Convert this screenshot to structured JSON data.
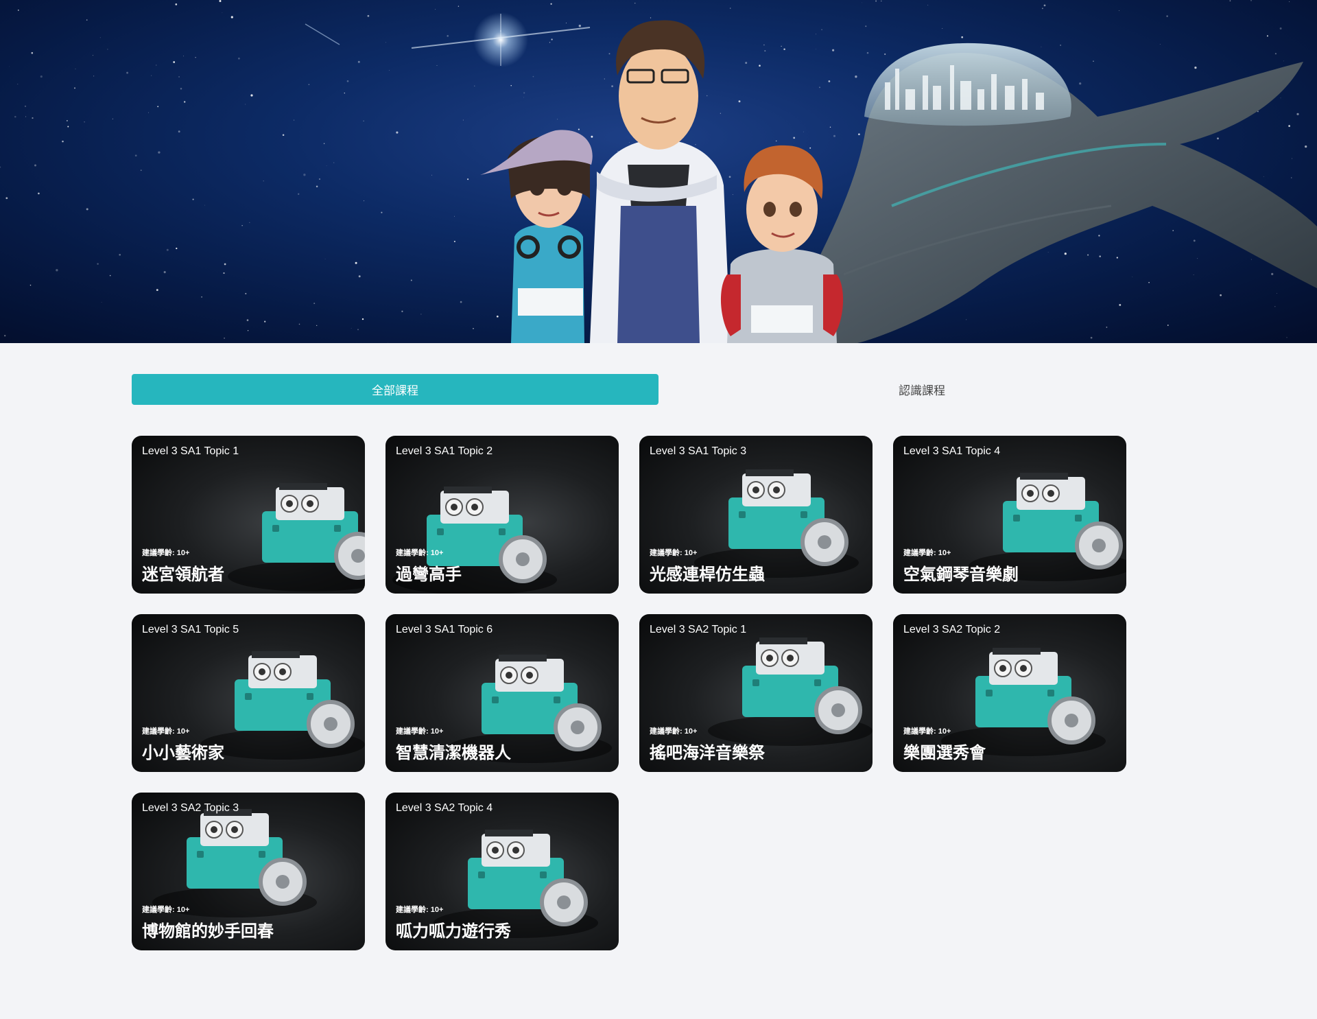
{
  "tabs": [
    {
      "label": "全部課程",
      "active": true
    },
    {
      "label": "認識課程",
      "active": false
    }
  ],
  "colors": {
    "accent": "#26b6be",
    "robot": "#2fb7ad"
  },
  "courses": [
    {
      "topic": "Level 3 SA1 Topic 1",
      "age": "建議學齡: 10+",
      "title": "迷宮領航者"
    },
    {
      "topic": "Level 3 SA1 Topic 2",
      "age": "建議學齡: 10+",
      "title": "過彎高手"
    },
    {
      "topic": "Level 3 SA1 Topic 3",
      "age": "建議學齡: 10+",
      "title": "光感連桿仿生蟲"
    },
    {
      "topic": "Level 3 SA1 Topic 4",
      "age": "建議學齡: 10+",
      "title": "空氣鋼琴音樂劇"
    },
    {
      "topic": "Level 3 SA1 Topic 5",
      "age": "建議學齡: 10+",
      "title": "小小藝術家"
    },
    {
      "topic": "Level 3 SA1 Topic 6",
      "age": "建議學齡: 10+",
      "title": "智慧清潔機器人"
    },
    {
      "topic": "Level 3 SA2 Topic 1",
      "age": "建議學齡: 10+",
      "title": "搖吧海洋音樂祭"
    },
    {
      "topic": "Level 3 SA2 Topic 2",
      "age": "建議學齡: 10+",
      "title": "樂團選秀會"
    },
    {
      "topic": "Level 3 SA2 Topic 3",
      "age": "建議學齡: 10+",
      "title": "博物館的妙手回春"
    },
    {
      "topic": "Level 3 SA2 Topic 4",
      "age": "建議學齡: 10+",
      "title": "呱力呱力遊行秀"
    }
  ]
}
